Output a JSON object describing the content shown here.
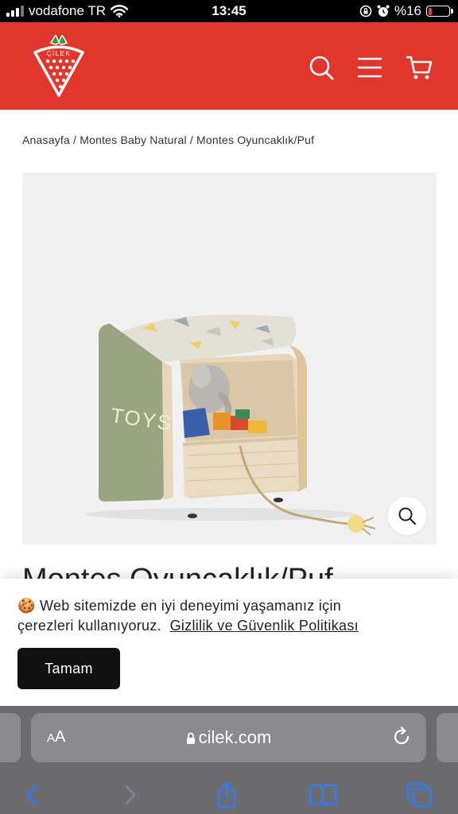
{
  "status_bar": {
    "carrier": "vodafone TR",
    "time": "13:45",
    "battery_text": "%16",
    "battery_level": 0.16,
    "icons": [
      "signal-icon",
      "wifi-icon",
      "screen-lock-icon",
      "alarm-icon",
      "battery-icon"
    ]
  },
  "header": {
    "logo_text": "ÇİLEK",
    "brand_color": "#e1362c",
    "icons": [
      "search-icon",
      "menu-icon",
      "cart-icon"
    ]
  },
  "breadcrumb": {
    "text": "Anasayfa / Montes Baby Natural / Montes Oyuncaklık/Puf"
  },
  "product": {
    "image_text": "TOYS",
    "title": "Montes Oyuncaklık/Puf",
    "zoom_icon": "zoom-icon"
  },
  "cookie_banner": {
    "emoji": "🍪",
    "text_line1": "Web sitemizde en iyi deneyimi yaşamanız için",
    "text_line2": "çerezleri kullanıyoruz.",
    "link_text": "Gizlilik ve Güvenlik Politikası",
    "button_label": "Tamam"
  },
  "safari": {
    "aa_label_big": "A",
    "aa_label_small": "A",
    "url": "cilek.com",
    "toolbar": [
      "back-icon",
      "forward-icon",
      "share-icon",
      "bookmarks-icon",
      "tabs-icon"
    ]
  }
}
